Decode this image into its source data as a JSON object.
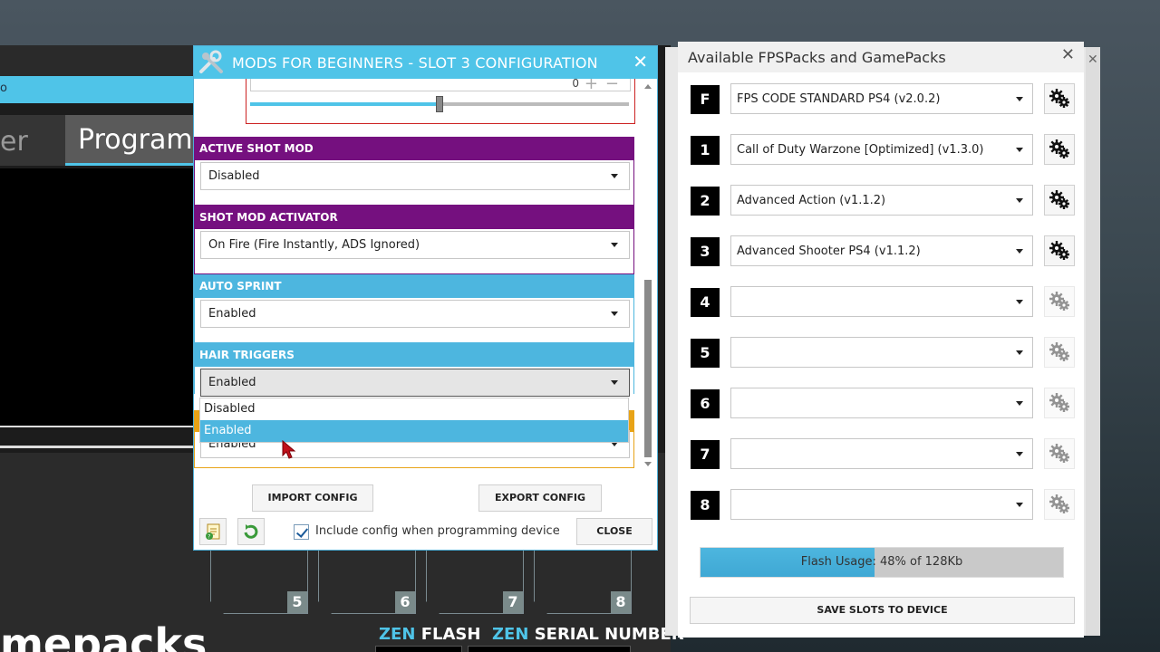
{
  "background_app": {
    "tab_partial": "er",
    "tab_active": "Program",
    "bottom_text": "mepacks",
    "slots": [
      "5",
      "6",
      "7",
      "8"
    ],
    "zen1": "ZEN",
    "flash": "FLASH",
    "zen2": "ZEN",
    "serial": "SERIAL NUMBER",
    "bluebar_text": "o"
  },
  "config_dialog": {
    "title": "MODS FOR BEGINNERS - SLOT 3 CONFIGURATION",
    "close_icon": "close-icon",
    "slider_value": "0",
    "slider_level": 0.5,
    "sections": [
      {
        "label": "ACTIVE SHOT MOD",
        "value": "Disabled",
        "color": "#75107f"
      },
      {
        "label": "SHOT MOD ACTIVATOR",
        "value": "On Fire (Fire Instantly, ADS Ignored)",
        "color": "#75107f"
      },
      {
        "label": "AUTO SPRINT",
        "value": "Enabled",
        "color": "#4db6df"
      },
      {
        "label": "HAIR TRIGGERS",
        "value": "Enabled",
        "color": "#4db6df"
      }
    ],
    "dropdown_options": [
      "Disabled",
      "Enabled"
    ],
    "dropdown_selected": "Enabled",
    "next_section_value": "Enabled",
    "import_label": "IMPORT CONFIG",
    "export_label": "EXPORT CONFIG",
    "include_label": "Include config when programming device",
    "include_checked": true,
    "close_label": "CLOSE"
  },
  "fps_window": {
    "title": "Available FPSPacks and GamePacks",
    "slots": [
      {
        "key": "F",
        "value": "FPS CODE STANDARD PS4 (v2.0.2)",
        "active": true
      },
      {
        "key": "1",
        "value": "Call of Duty Warzone [Optimized] (v1.3.0)",
        "active": true
      },
      {
        "key": "2",
        "value": "Advanced Action (v1.1.2)",
        "active": true
      },
      {
        "key": "3",
        "value": "Advanced Shooter PS4 (v1.1.2)",
        "active": true
      },
      {
        "key": "4",
        "value": "",
        "active": false
      },
      {
        "key": "5",
        "value": "",
        "active": false
      },
      {
        "key": "6",
        "value": "",
        "active": false
      },
      {
        "key": "7",
        "value": "",
        "active": false
      },
      {
        "key": "8",
        "value": "",
        "active": false
      }
    ],
    "flash_label": "Flash Usage: 48% of 128Kb",
    "flash_percent": 48,
    "save_label": "SAVE SLOTS TO DEVICE"
  }
}
